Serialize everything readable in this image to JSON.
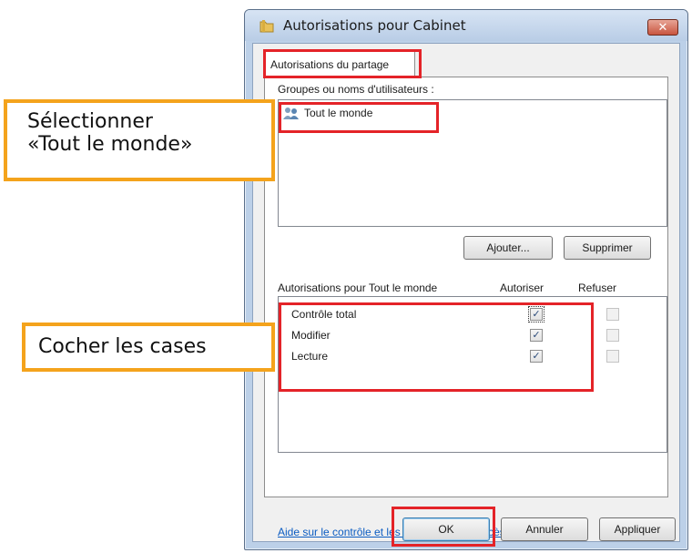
{
  "window": {
    "title": "Autorisations pour Cabinet",
    "close_glyph": "✕"
  },
  "tab": {
    "label": "Autorisations du partage"
  },
  "groups": {
    "label": "Groupes ou noms d'utilisateurs :",
    "items": [
      {
        "name": "Tout le monde",
        "icon": "users-icon"
      }
    ]
  },
  "buttons": {
    "add": "Ajouter...",
    "remove": "Supprimer",
    "ok": "OK",
    "cancel": "Annuler",
    "apply": "Appliquer"
  },
  "permissions": {
    "label": "Autorisations pour Tout le monde",
    "col_allow": "Autoriser",
    "col_deny": "Refuser",
    "rows": [
      {
        "name": "Contrôle total",
        "allow": true,
        "deny": false
      },
      {
        "name": "Modifier",
        "allow": true,
        "deny": false
      },
      {
        "name": "Lecture",
        "allow": true,
        "deny": false
      }
    ]
  },
  "help_link": "Aide sur le contrôle et les autorisations d'accès",
  "annotations": {
    "select_line1": "Sélectionner",
    "select_line2": "«Tout le monde»",
    "check": "Cocher les cases",
    "highlight_color": "#e42328",
    "callout_color": "#f4a31c"
  }
}
